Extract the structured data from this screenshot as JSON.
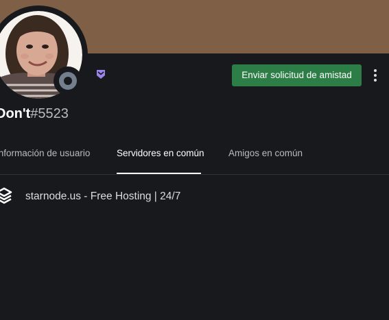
{
  "profile": {
    "username": "Don't",
    "discriminator": "#5523",
    "status": "offline",
    "badge_icon": "nitro-badge-icon",
    "colors": {
      "banner": "#7f5f45",
      "background": "#18191c",
      "badge": "#9b84ec",
      "status_offline": "#747f8d"
    }
  },
  "actions": {
    "send_friend_request_label": "Enviar solicitud de amistad",
    "send_friend_request_color": "#2d7d46",
    "more_icon": "more-vertical-icon"
  },
  "tabs": [
    {
      "label": "Información de usuario",
      "active": false
    },
    {
      "label": "Servidores en común",
      "active": true
    },
    {
      "label": "Amigos en común",
      "active": false
    }
  ],
  "mutual_servers": [
    {
      "name": "starnode.us - Free Hosting | 24/7",
      "icon": "starnode-server-icon"
    }
  ]
}
